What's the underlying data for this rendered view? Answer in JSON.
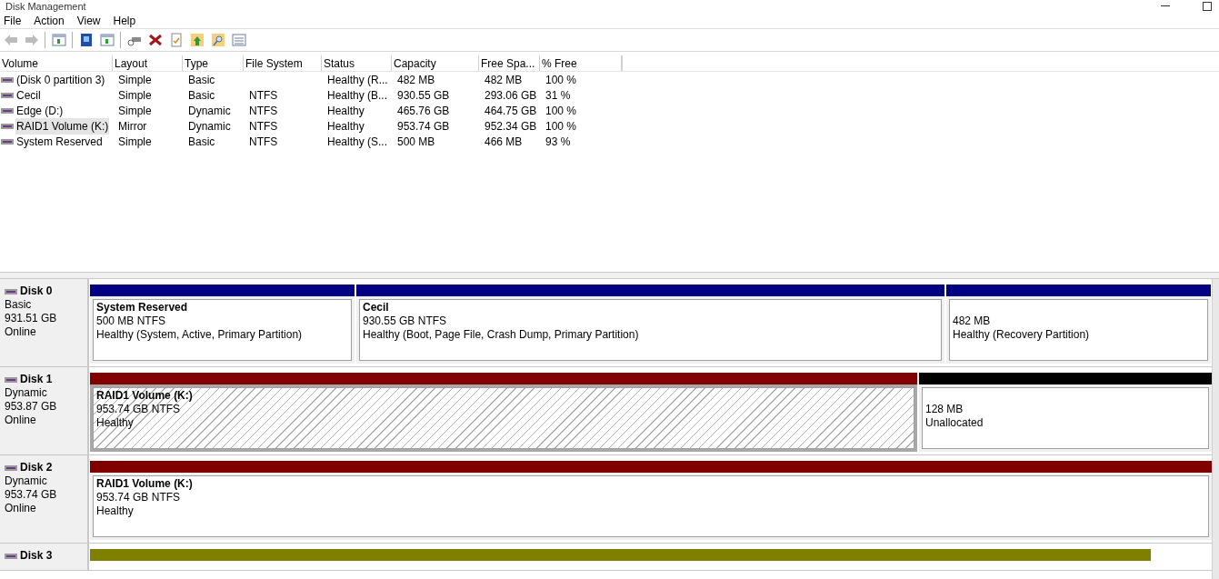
{
  "window": {
    "title": "Disk Management"
  },
  "menu": [
    "File",
    "Action",
    "View",
    "Help"
  ],
  "toolbar": [
    {
      "kind": "back",
      "disabled": true
    },
    {
      "kind": "forward",
      "disabled": true
    },
    {
      "kind": "pane",
      "disabled": false
    },
    {
      "kind": "help",
      "disabled": false
    },
    {
      "kind": "pane",
      "disabled": false
    },
    {
      "kind": "connect",
      "disabled": false
    },
    {
      "kind": "delete",
      "disabled": false
    },
    {
      "kind": "properties",
      "disabled": false
    },
    {
      "kind": "folder-up",
      "disabled": false
    },
    {
      "kind": "folder-search",
      "disabled": false
    },
    {
      "kind": "list",
      "disabled": false
    }
  ],
  "volume_table": {
    "columns": [
      "Volume",
      "Layout",
      "Type",
      "File System",
      "Status",
      "Capacity",
      "Free Spa...",
      "% Free"
    ],
    "rows": [
      {
        "selected": false,
        "cells": [
          "(Disk 0 partition 3)",
          "Simple",
          "Basic",
          "",
          "Healthy (R...",
          "482 MB",
          "482 MB",
          "100 %"
        ]
      },
      {
        "selected": false,
        "cells": [
          "Cecil",
          "Simple",
          "Basic",
          "NTFS",
          "Healthy (B...",
          "930.55 GB",
          "293.06 GB",
          "31 %"
        ]
      },
      {
        "selected": false,
        "cells": [
          "Edge (D:)",
          "Simple",
          "Dynamic",
          "NTFS",
          "Healthy",
          "465.76 GB",
          "464.75 GB",
          "100 %"
        ]
      },
      {
        "selected": true,
        "cells": [
          "RAID1 Volume (K:)",
          "Mirror",
          "Dynamic",
          "NTFS",
          "Healthy",
          "953.74 GB",
          "952.34 GB",
          "100 %"
        ]
      },
      {
        "selected": false,
        "cells": [
          "System Reserved",
          "Simple",
          "Basic",
          "NTFS",
          "Healthy (S...",
          "500 MB",
          "466 MB",
          "93 %"
        ]
      }
    ]
  },
  "disks": [
    {
      "name": "Disk 0",
      "type": "Basic",
      "size": "931.51 GB",
      "state": "Online",
      "partitions": [
        {
          "color": "#000080",
          "selected": false,
          "title": "System Reserved",
          "size": "500 MB NTFS",
          "status": "Healthy (System, Active, Primary Partition)"
        },
        {
          "color": "#000080",
          "selected": false,
          "title": "Cecil",
          "size": "930.55 GB NTFS",
          "status": "Healthy (Boot, Page File, Crash Dump, Primary Partition)"
        },
        {
          "color": "#000080",
          "selected": false,
          "size": "482 MB",
          "status": "Healthy (Recovery Partition)"
        }
      ]
    },
    {
      "name": "Disk 1",
      "type": "Dynamic",
      "size": "953.87 GB",
      "state": "Online",
      "partitions": [
        {
          "color": "#800000",
          "selected": true,
          "title": "RAID1 Volume  (K:)",
          "size": "953.74 GB NTFS",
          "status": "Healthy"
        },
        {
          "color": "#000000",
          "selected": false,
          "size": "128 MB",
          "status": "Unallocated"
        }
      ]
    },
    {
      "name": "Disk 2",
      "type": "Dynamic",
      "size": "953.74 GB",
      "state": "Online",
      "partitions": [
        {
          "color": "#800000",
          "selected": false,
          "title": "RAID1 Volume  (K:)",
          "size": "953.74 GB NTFS",
          "status": "Healthy"
        }
      ]
    },
    {
      "name": "Disk 3",
      "partitions": [
        {
          "color": "#808000"
        }
      ]
    }
  ]
}
